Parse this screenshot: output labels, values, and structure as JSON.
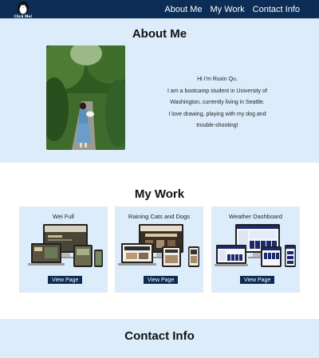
{
  "nav": {
    "logo_text": "Click Me!",
    "links": [
      {
        "label": "About Me"
      },
      {
        "label": "My Work"
      },
      {
        "label": "Contact Info"
      }
    ],
    "background": "#0c2d55"
  },
  "about": {
    "title": "About Me",
    "bio_lines": [
      "Hi I'm Ruxin Qu.",
      "I am a bootcamp student in University of",
      "Washington, currently living in Seattle.",
      "I love drawing, playing with my dog and",
      "trouble-shooting!"
    ],
    "background": "#dcecfb"
  },
  "work": {
    "title": "My Work",
    "cards": [
      {
        "title": "Wei Full",
        "button": "View Page"
      },
      {
        "title": "Raining Cats and Dogs",
        "button": "View Page"
      },
      {
        "title": "Weather Dashboard",
        "button": "View Page"
      }
    ]
  },
  "contact": {
    "title": "Contact Info"
  },
  "colors": {
    "navy": "#0c2d55",
    "light_blue": "#dcecfb"
  }
}
